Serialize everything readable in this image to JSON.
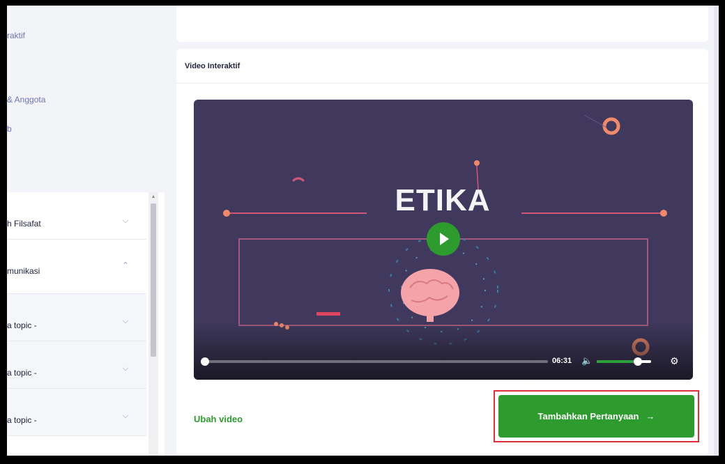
{
  "sidebar": {
    "links": [
      {
        "label": "raktif"
      },
      {
        "label": "& Anggota"
      },
      {
        "label": "b"
      }
    ],
    "topics": [
      {
        "label": "h Filsafat",
        "expanded": false
      },
      {
        "label": "munikasi",
        "expanded": true
      },
      {
        "label": "a topic -",
        "expanded": false
      },
      {
        "label": "a topic -",
        "expanded": false
      },
      {
        "label": "a topic -",
        "expanded": false
      }
    ]
  },
  "card": {
    "title": "Video Interaktif"
  },
  "video": {
    "title_text": "ETIKA",
    "time": "06:31",
    "progress": 0.0,
    "volume": 0.75
  },
  "actions": {
    "change_video": "Ubah video",
    "add_question": "Tambahkan Pertanyaan",
    "add_question_arrow": "→"
  },
  "icons": {
    "play": "play-icon",
    "volume": "volume-icon",
    "settings": "gear-icon",
    "chevron_down": "chevron-down-icon",
    "chevron_up": "chevron-up-icon"
  },
  "colors": {
    "accent_green": "#2e9b2f",
    "sidebar_link": "#6f74b8",
    "video_bg": "#40395d",
    "highlight_red": "#e02f3b"
  }
}
